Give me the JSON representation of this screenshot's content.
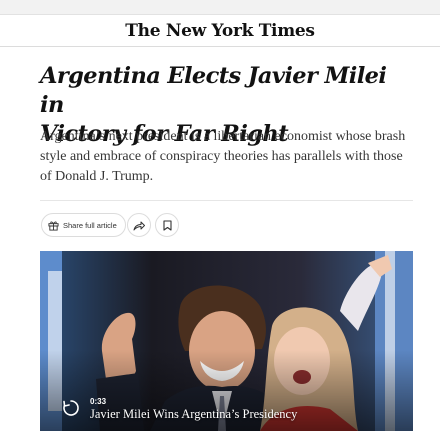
{
  "masthead": {
    "logo": "The New York Times"
  },
  "article": {
    "headline_line1": "Argentina Elects Javier Milei in",
    "headline_line2": "Victory for Far Right",
    "summary": "Argentina’s next president is a libertarian economist whose brash style and embrace of conspiracy theories has parallels with those of Donald J. Trump."
  },
  "toolbar": {
    "share_label": "Share full article",
    "share_icon": "gift-icon",
    "forward_icon": "share-arrow-icon",
    "save_icon": "bookmark-icon"
  },
  "video": {
    "duration": "0:33",
    "caption": "Javier Milei Wins Argentina’s Presidency",
    "play_icon": "replay-icon"
  }
}
